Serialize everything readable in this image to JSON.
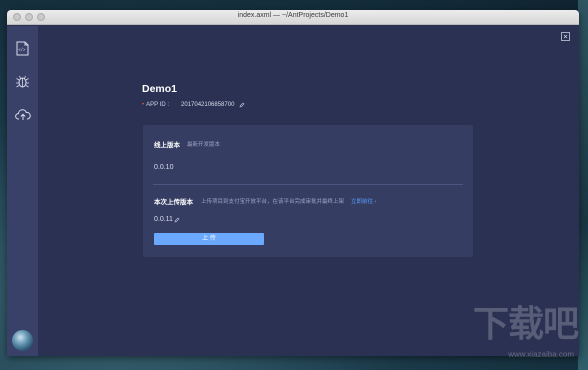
{
  "window": {
    "title": "index.axml — ~/AntProjects/Demo1"
  },
  "sidebar": {
    "items": [
      {
        "icon": "file-code-icon"
      },
      {
        "icon": "bug-icon"
      },
      {
        "icon": "cloud-upload-icon"
      }
    ]
  },
  "main": {
    "title": "Demo1",
    "app_id_label": "APP ID :",
    "app_id_value": "2017042106858700",
    "online": {
      "title": "线上版本",
      "subtitle": "最新开发版本",
      "version": "0.0.10"
    },
    "upload": {
      "title": "本次上传版本",
      "hint": "上传项目到支付宝开放平台，在该平台完成审批并最终上架",
      "link": "立即前往",
      "version": "0.0.11",
      "button": "上 传"
    }
  },
  "watermark": {
    "logo": "下载吧",
    "url": "www.xiazaiba.com"
  },
  "colors": {
    "accent": "#6ba8ff",
    "link": "#5aa0ff",
    "panel": "#2a3152",
    "sidebar": "#3a4169"
  }
}
